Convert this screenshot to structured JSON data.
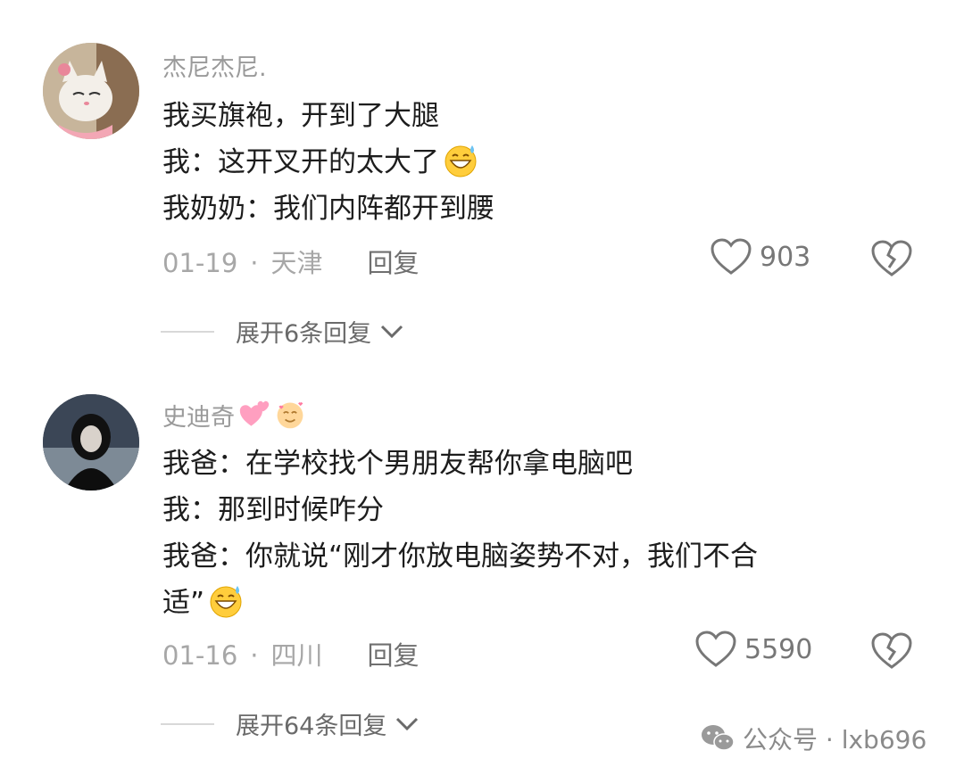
{
  "comments": [
    {
      "username": "杰尼杰尼.",
      "lines": [
        "我买旗袍，开到了大腿",
        "我：这开叉开的太大了",
        "我奶奶：我们内阵都开到腰"
      ],
      "date": "01-19",
      "location": "天津",
      "reply_label": "回复",
      "likes": "903",
      "expand_label": "展开6条回复"
    },
    {
      "username": "史迪奇",
      "lines": [
        "我爸：在学校找个男朋友帮你拿电脑吧",
        "我：那到时候咋分",
        "我爸：你就说“刚才你放电脑姿势不对，我们不合",
        "适”"
      ],
      "date": "01-16",
      "location": "四川",
      "reply_label": "回复",
      "likes": "5590",
      "expand_label": "展开64条回复"
    }
  ],
  "watermark": {
    "text": "公众号 · lxb696",
    "icon": "wechat-icon"
  },
  "icons": [
    "heart-outline-icon",
    "broken-heart-icon",
    "chevron-down-icon",
    "sweat-smile-emoji",
    "two-hearts-emoji",
    "smiling-hearts-emoji"
  ]
}
